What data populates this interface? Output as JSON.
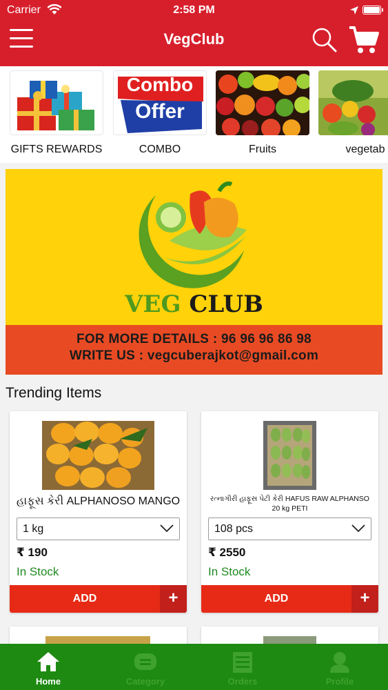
{
  "status_bar": {
    "carrier": "Carrier",
    "time": "2:58 PM"
  },
  "nav": {
    "title": "VegClub"
  },
  "categories": [
    {
      "label": "GIFTS REWARDS",
      "icon": "gift-box-image"
    },
    {
      "label": "COMBO",
      "icon": "combo-offer-image",
      "image_text_1": "Combo",
      "image_text_2": "Offer"
    },
    {
      "label": "Fruits",
      "icon": "fruits-image"
    },
    {
      "label": "vegetab",
      "icon": "vegetables-image"
    }
  ],
  "banner": {
    "brand_veg": "VEG",
    "brand_club": "CLUB",
    "line1": "FOR MORE DETAILS : 96 96 96 86 98",
    "line2": "WRITE US : vegcuberajkot@gmail.com"
  },
  "trending": {
    "title": "Trending Items",
    "products": [
      {
        "name": "હાફૂસ કેરી ALPHANOSO MANGO",
        "quantity": "1 kg",
        "price": "₹ 190",
        "stock": "In Stock",
        "add_label": "ADD",
        "plus_label": "+"
      },
      {
        "name": "રત્નાગીરી હાફૂસ પેટી કેરી HAFUS RAW ALPHANSO 20 kg PETI",
        "quantity": "108 pcs",
        "price": "₹ 2550",
        "stock": "In Stock",
        "add_label": "ADD",
        "plus_label": "+"
      }
    ]
  },
  "tabs": [
    {
      "label": "Home",
      "icon": "home-icon",
      "active": true
    },
    {
      "label": "Category",
      "icon": "category-icon",
      "active": false
    },
    {
      "label": "Orders",
      "icon": "orders-icon",
      "active": false
    },
    {
      "label": "Profile",
      "icon": "profile-icon",
      "active": false
    }
  ],
  "colors": {
    "header_red": "#d71f2c",
    "banner_yellow": "#ffd20a",
    "banner_orange": "#e84b24",
    "add_red": "#e62a16",
    "plus_dark_red": "#c1201b",
    "stock_green": "#1f8a1f",
    "tabbar_green": "#1e8a12"
  }
}
